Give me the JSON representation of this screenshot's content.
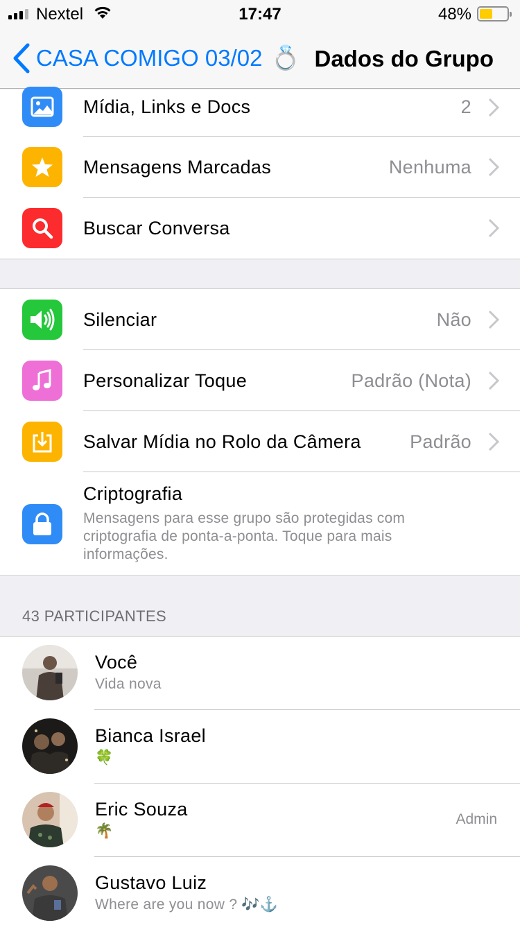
{
  "status_bar": {
    "carrier": "Nextel",
    "time": "17:47",
    "battery_percent": "48%",
    "battery_level": 0.48,
    "signal_bars": 3,
    "signal_bars_total": 4
  },
  "nav": {
    "back_label": "CASA COMIGO 03/02",
    "back_emoji": "💍",
    "title": "Dados do Grupo"
  },
  "colors": {
    "accent": "#007aff",
    "media_icon": "#2f8cf7",
    "starred_icon": "#fdb400",
    "search_icon": "#fc2b2d",
    "mute_icon": "#25c73b",
    "tone_icon": "#ee6fd6",
    "save_icon": "#fdb400",
    "crypto_icon": "#2f8cf7"
  },
  "group1": {
    "media": {
      "label": "Mídia, Links e Docs",
      "value": "2",
      "icon": "photo-icon"
    },
    "starred": {
      "label": "Mensagens Marcadas",
      "value": "Nenhuma",
      "icon": "star-icon"
    },
    "search": {
      "label": "Buscar Conversa",
      "icon": "magnifier-icon"
    }
  },
  "group2": {
    "mute": {
      "label": "Silenciar",
      "value": "Não",
      "icon": "speaker-icon"
    },
    "tone": {
      "label": "Personalizar Toque",
      "value": "Padrão (Nota)",
      "icon": "music-note-icon"
    },
    "save_media": {
      "label": "Salvar Mídia no Rolo da Câmera",
      "value": "Padrão",
      "icon": "download-icon"
    },
    "encryption": {
      "title": "Criptografia",
      "description": "Mensagens para esse grupo são protegidas com criptografia de ponta-a-ponta. Toque para mais informações.",
      "icon": "lock-icon"
    }
  },
  "participants": {
    "header": "43 PARTICIPANTES",
    "items": [
      {
        "name": "Você",
        "status": "Vida nova",
        "role": ""
      },
      {
        "name": "Bianca Israel",
        "status": "🍀",
        "role": ""
      },
      {
        "name": "Eric Souza",
        "status": "🌴",
        "role": "Admin"
      },
      {
        "name": "Gustavo Luiz",
        "status": "Where are you now ? 🎶⚓️",
        "role": ""
      }
    ]
  }
}
